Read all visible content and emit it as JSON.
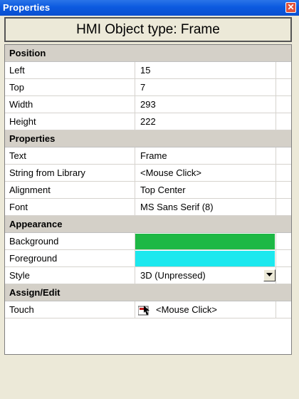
{
  "window": {
    "title": "Properties",
    "close_label": "✕"
  },
  "object_type": "HMI Object type: Frame",
  "sections": {
    "position": {
      "label": "Position",
      "left": {
        "name": "Left",
        "value": "15"
      },
      "top": {
        "name": "Top",
        "value": "7"
      },
      "width": {
        "name": "Width",
        "value": "293"
      },
      "height": {
        "name": "Height",
        "value": "222"
      }
    },
    "properties": {
      "label": "Properties",
      "text": {
        "name": "Text",
        "value": "Frame"
      },
      "string": {
        "name": "String from Library",
        "value": "<Mouse Click>"
      },
      "alignment": {
        "name": "Alignment",
        "value": "Top Center"
      },
      "font": {
        "name": "Font",
        "value": "MS Sans Serif (8)"
      }
    },
    "appearance": {
      "label": "Appearance",
      "background": {
        "name": "Background",
        "color": "#1db845"
      },
      "foreground": {
        "name": "Foreground",
        "color": "#1ce8ee"
      },
      "style": {
        "name": "Style",
        "value": "3D (Unpressed)",
        "dropdown_icon": "chevron-down-icon"
      }
    },
    "assign_edit": {
      "label": "Assign/Edit",
      "touch": {
        "name": "Touch",
        "value": "<Mouse Click>",
        "icon": "mouse-click-icon"
      }
    }
  }
}
